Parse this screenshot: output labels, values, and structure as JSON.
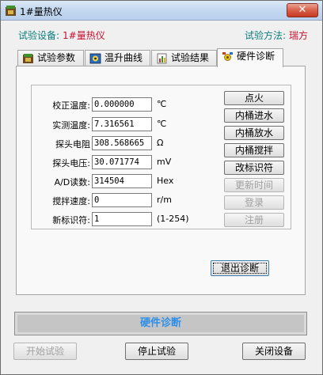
{
  "window": {
    "title": "1#量热仪",
    "close_label": "✕"
  },
  "info": {
    "device_label": "试验设备:",
    "device_value": "1#量热仪",
    "method_label": "试验方法:",
    "method_value": "瑞方"
  },
  "tabs": [
    {
      "label": "试验参数",
      "icon": "gear-icon"
    },
    {
      "label": "温升曲线",
      "icon": "chart-icon"
    },
    {
      "label": "试验结果",
      "icon": "result-icon"
    },
    {
      "label": "硬件诊断",
      "icon": "hardware-icon",
      "active": true
    }
  ],
  "fields": [
    {
      "label": "校正温度:",
      "value": "0.000000",
      "unit": "℃"
    },
    {
      "label": "实测温度:",
      "value": "7.316561",
      "unit": "℃"
    },
    {
      "label": "探头电阻",
      "value": "308.568665",
      "unit": "Ω"
    },
    {
      "label": "探头电压:",
      "value": "30.071774",
      "unit": "mV"
    },
    {
      "label": "A/D读数:",
      "value": "314504",
      "unit": "Hex"
    },
    {
      "label": "搅拌速度:",
      "value": "0",
      "unit": "r/m"
    },
    {
      "label": "新标识符:",
      "value": "1",
      "unit": "(1-254)"
    }
  ],
  "side_buttons": [
    {
      "label": "点火",
      "enabled": true
    },
    {
      "label": "内桶进水",
      "enabled": true
    },
    {
      "label": "内桶放水",
      "enabled": true
    },
    {
      "label": "内桶搅拌",
      "enabled": true
    },
    {
      "label": "改标识符",
      "enabled": true
    },
    {
      "label": "更新时间",
      "enabled": false
    },
    {
      "label": "登录",
      "enabled": false
    },
    {
      "label": "注册",
      "enabled": false
    }
  ],
  "exit_button": "退出诊断",
  "status": "硬件诊断",
  "bottom_buttons": {
    "start": "开始试验",
    "stop": "停止试验",
    "close": "关闭设备"
  },
  "colors": {
    "label_teal": "#0c7e7c",
    "value_red": "#c8102e",
    "status_blue": "#2f8fe8"
  }
}
